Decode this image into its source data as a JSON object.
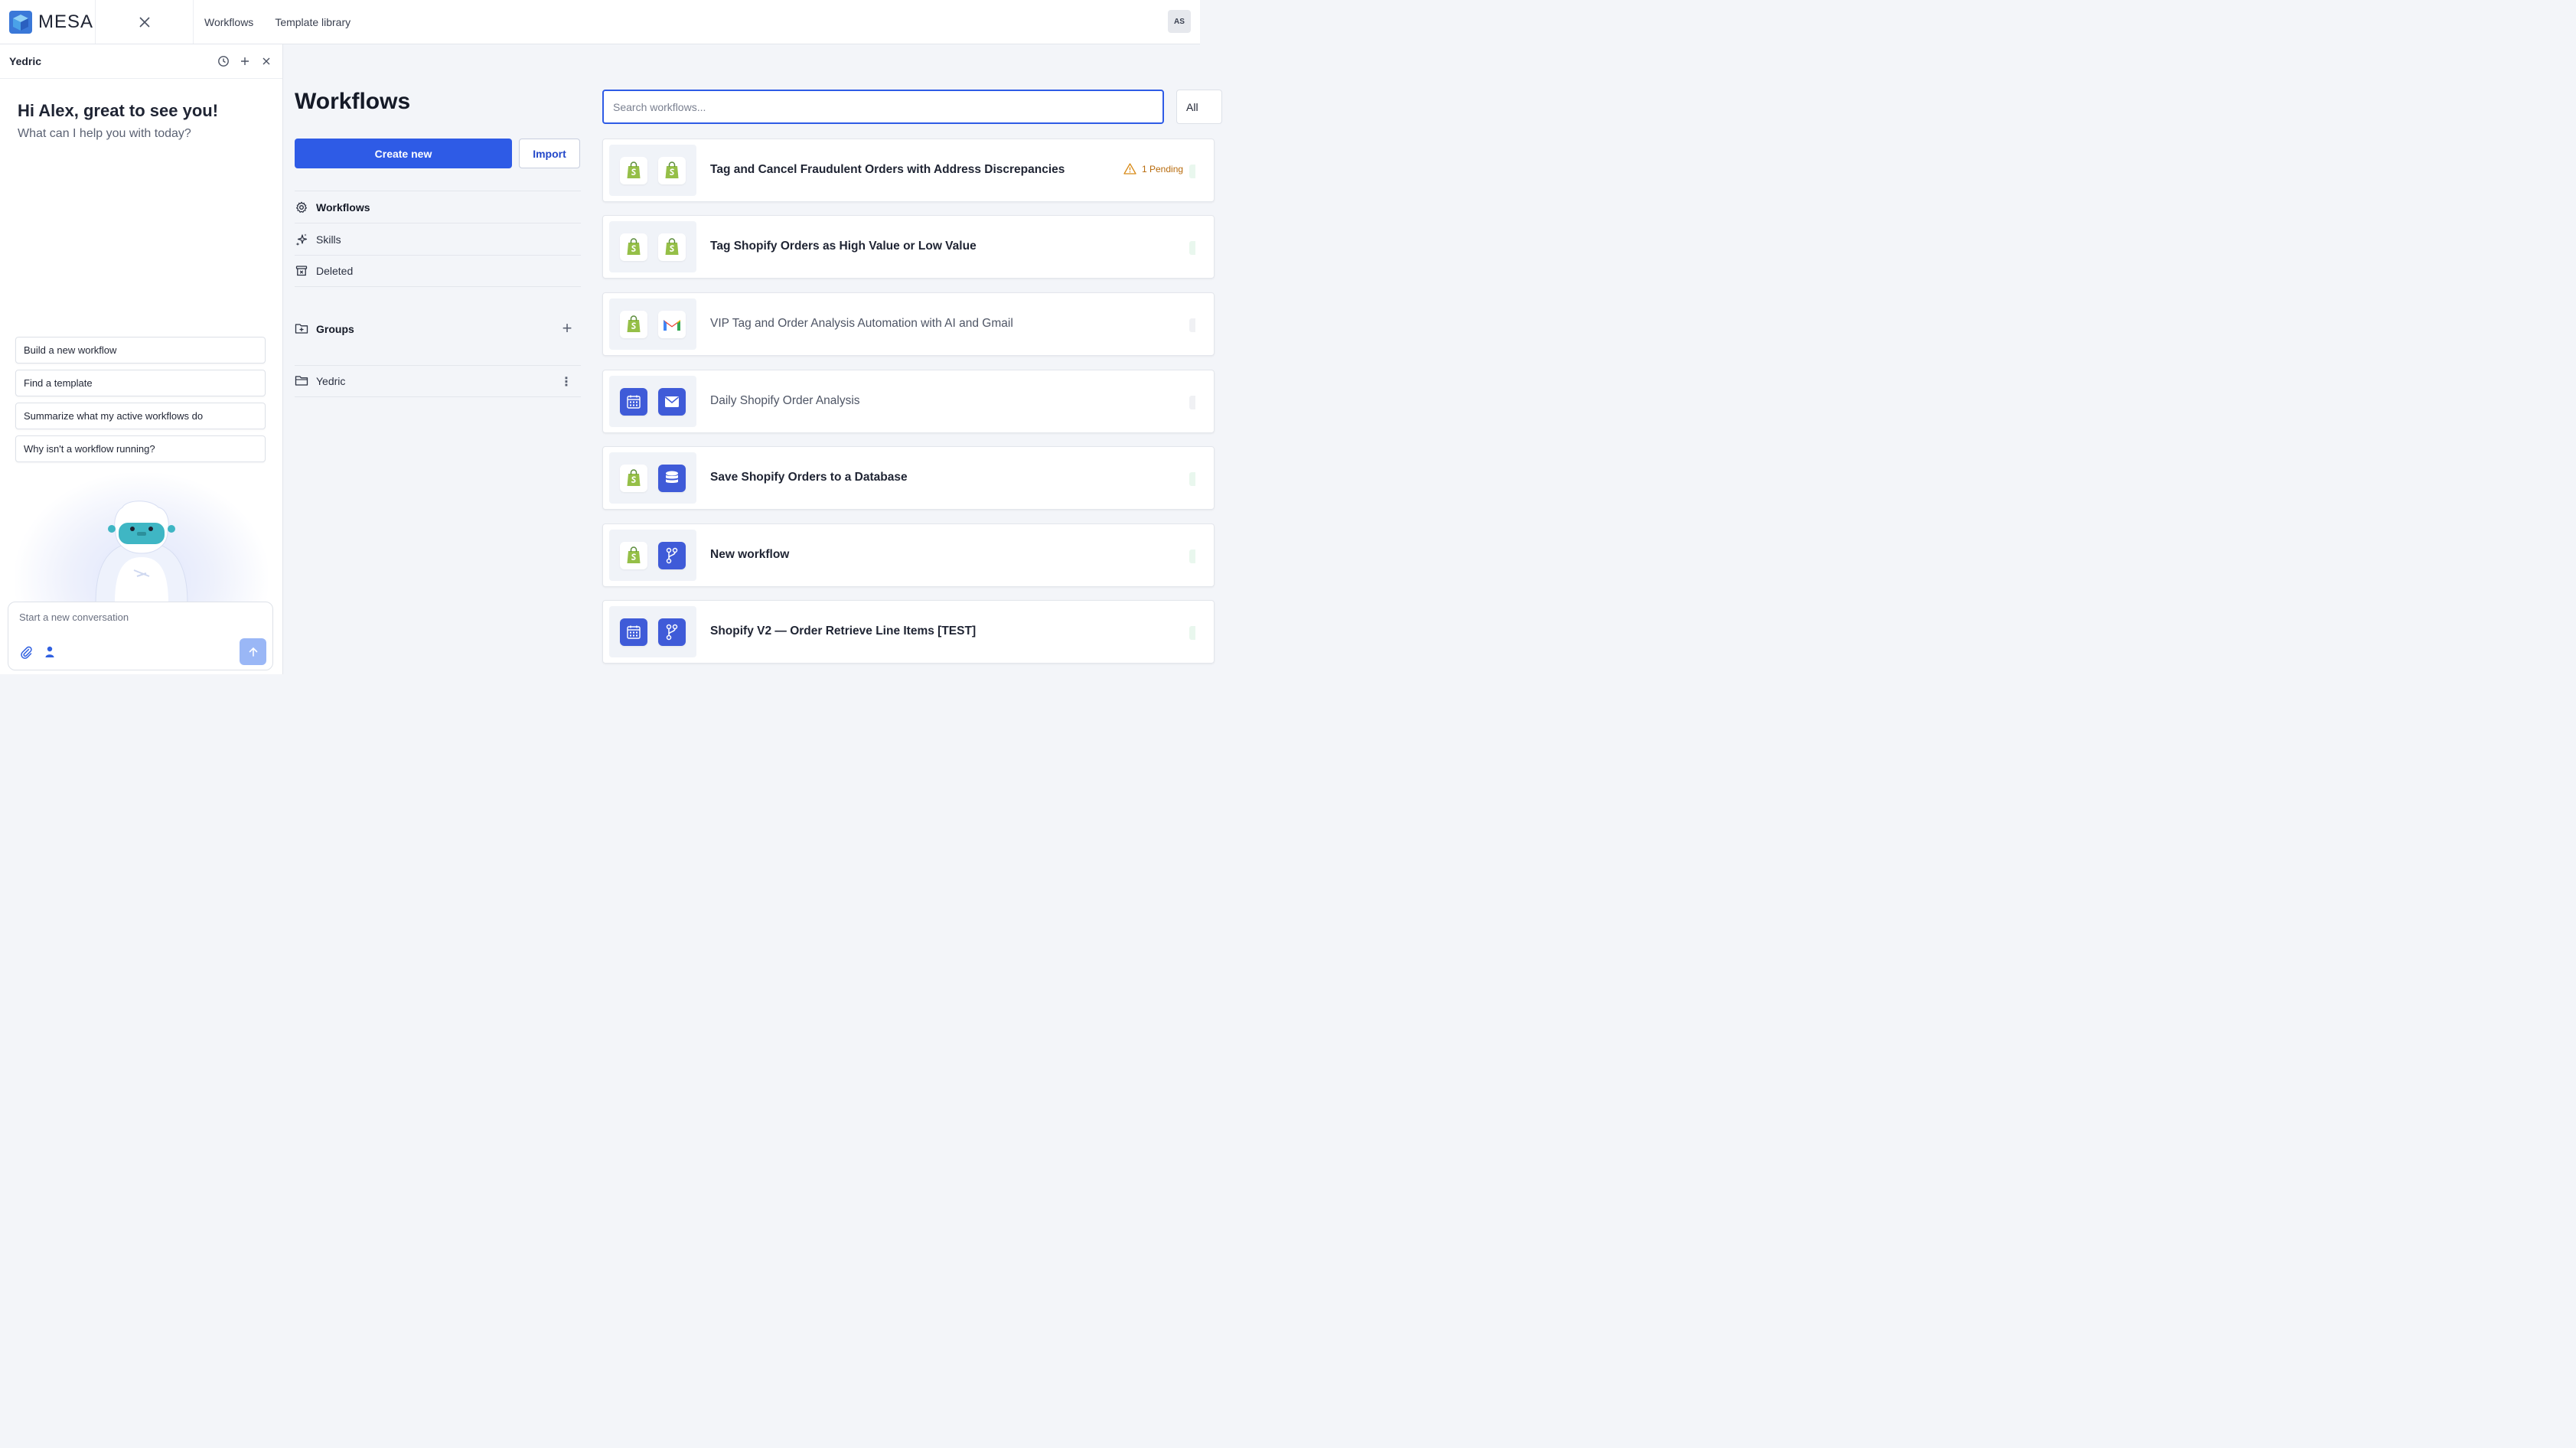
{
  "topbar": {
    "brand": "MESA",
    "nav": [
      "Workflows",
      "Template library"
    ],
    "avatar_initials": "AS"
  },
  "assistant": {
    "title": "Yedric",
    "greeting": "Hi Alex, great to see you!",
    "subtitle": "What can I help you with today?",
    "suggestions": [
      "Build a new workflow",
      "Find a template",
      "Summarize what my active workflows do",
      "Why isn't a workflow running?"
    ],
    "composer_placeholder": "Start a new conversation"
  },
  "main": {
    "title": "Workflows",
    "create_label": "Create new",
    "import_label": "Import",
    "nav": [
      {
        "label": "Workflows",
        "icon": "gear-icon",
        "active": true
      },
      {
        "label": "Skills",
        "icon": "sparkle-icon",
        "active": false
      },
      {
        "label": "Deleted",
        "icon": "archive-icon",
        "active": false
      }
    ],
    "groups_label": "Groups",
    "groups": [
      "Yedric"
    ]
  },
  "list": {
    "search_placeholder": "Search workflows...",
    "filter_label": "All",
    "workflows": [
      {
        "title": "Tag and Cancel Fraudulent Orders with Address Discrepancies",
        "apps": [
          "shopify",
          "shopify"
        ],
        "status": "1 Pending",
        "bold": true
      },
      {
        "title": "Tag Shopify Orders as High Value or Low Value",
        "apps": [
          "shopify",
          "shopify"
        ],
        "bold": true
      },
      {
        "title": "VIP Tag and Order Analysis Automation with AI and Gmail",
        "apps": [
          "shopify",
          "gmail"
        ],
        "bold": false
      },
      {
        "title": "Daily Shopify Order Analysis",
        "apps": [
          "calendar",
          "email"
        ],
        "bold": false
      },
      {
        "title": "Save Shopify Orders to a Database",
        "apps": [
          "shopify",
          "database"
        ],
        "bold": true
      },
      {
        "title": "New workflow",
        "apps": [
          "shopify",
          "branch"
        ],
        "bold": true
      },
      {
        "title": "Shopify V2 — Order Retrieve Line Items [TEST]",
        "apps": [
          "calendar",
          "branch"
        ],
        "bold": true
      }
    ]
  },
  "colors": {
    "primary": "#2e5be6",
    "shopify": "#95bf47",
    "app_blue": "#3f5bd8",
    "pending": "#b76a0b"
  }
}
